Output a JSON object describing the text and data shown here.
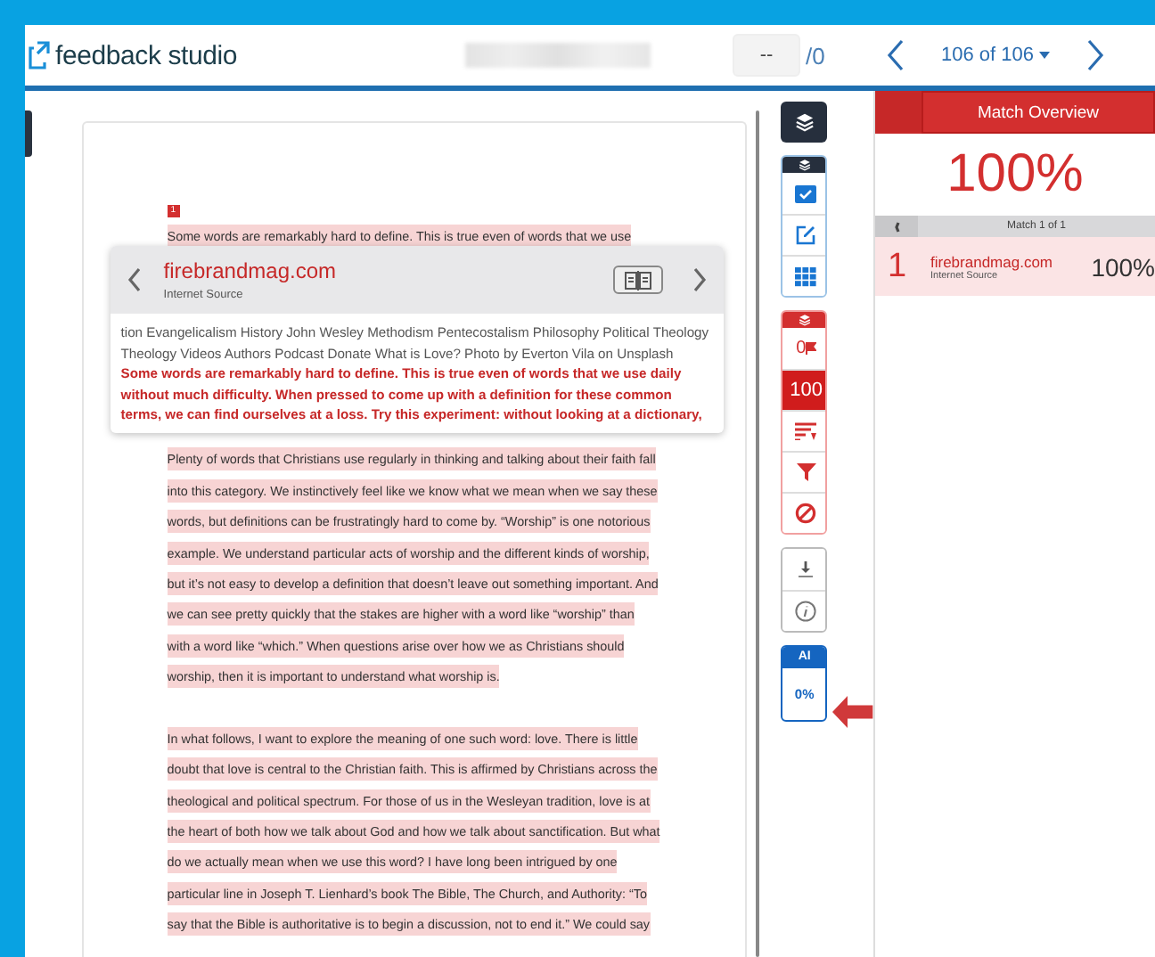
{
  "header": {
    "brand": "feedback studio",
    "page_field": {
      "value": "--"
    },
    "page_total": "/0",
    "submission": "106 of 106"
  },
  "document": {
    "match_marker": "1",
    "paragraphs": [
      {
        "highlighted": true,
        "lines": [
          "Some words are remarkably hard to define. This is true even of words that we use"
        ]
      },
      {
        "highlighted": true,
        "lines": [
          "Plenty of words that Christians use regularly in thinking and talking about their faith fall",
          "into this category. We instinctively feel like we know what we mean when we say these",
          "words, but definitions can be frustratingly hard to come by. “Worship” is one notorious",
          "example. We understand particular acts of worship and the different kinds of worship,",
          "but it’s not easy to develop a definition that doesn’t leave out something important. And",
          "we can see pretty quickly that the stakes are higher with a word like “worship” than",
          "with a word like “which.” When questions arise over how we as Christians should",
          "worship, then it is important to understand what worship is."
        ]
      },
      {
        "highlighted": true,
        "lines": [
          "In what follows, I want to explore the meaning of one such word: love. There is little",
          "doubt that love is central to the Christian faith. This is affirmed by Christians across the",
          "theological and political spectrum. For those of us in the Wesleyan tradition, love is at",
          "the heart of both how we talk about God and how we talk about sanctification. But what",
          "do we actually mean when we use this word? I have long been intrigued by one",
          "particular line in Joseph T. Lienhard’s book The Bible, The Church, and Authority: “To",
          "say that the Bible is authoritative is to begin a discussion, not to end it.” We could say"
        ]
      }
    ]
  },
  "popup": {
    "source": "firebrandmag.com",
    "source_type": "Internet Source",
    "context": "tion Evangelicalism History John Wesley Methodism Pentecostalism Philosophy Political Theology Theology Videos Authors Podcast Donate What is Love? Photo by Everton Vila on Unsplash",
    "matched_text": "Some words are remarkably hard to define. This is true even of words that we use daily without much difficulty. When pressed to come up with a definition for these common terms, we can find ourselves at a loss. Try this experiment: without looking at a dictionary,"
  },
  "toolbar": {
    "flags_count": "0",
    "similarity_score": "100",
    "ai": {
      "label": "AI",
      "score": "0%"
    }
  },
  "panel": {
    "title": "Match Overview",
    "score": "100%",
    "nav": "Match 1 of 1",
    "matches": [
      {
        "number": "1",
        "source": "firebrandmag.com",
        "source_type": "Internet Source",
        "percent": "100%",
        "selected": true
      }
    ]
  }
}
